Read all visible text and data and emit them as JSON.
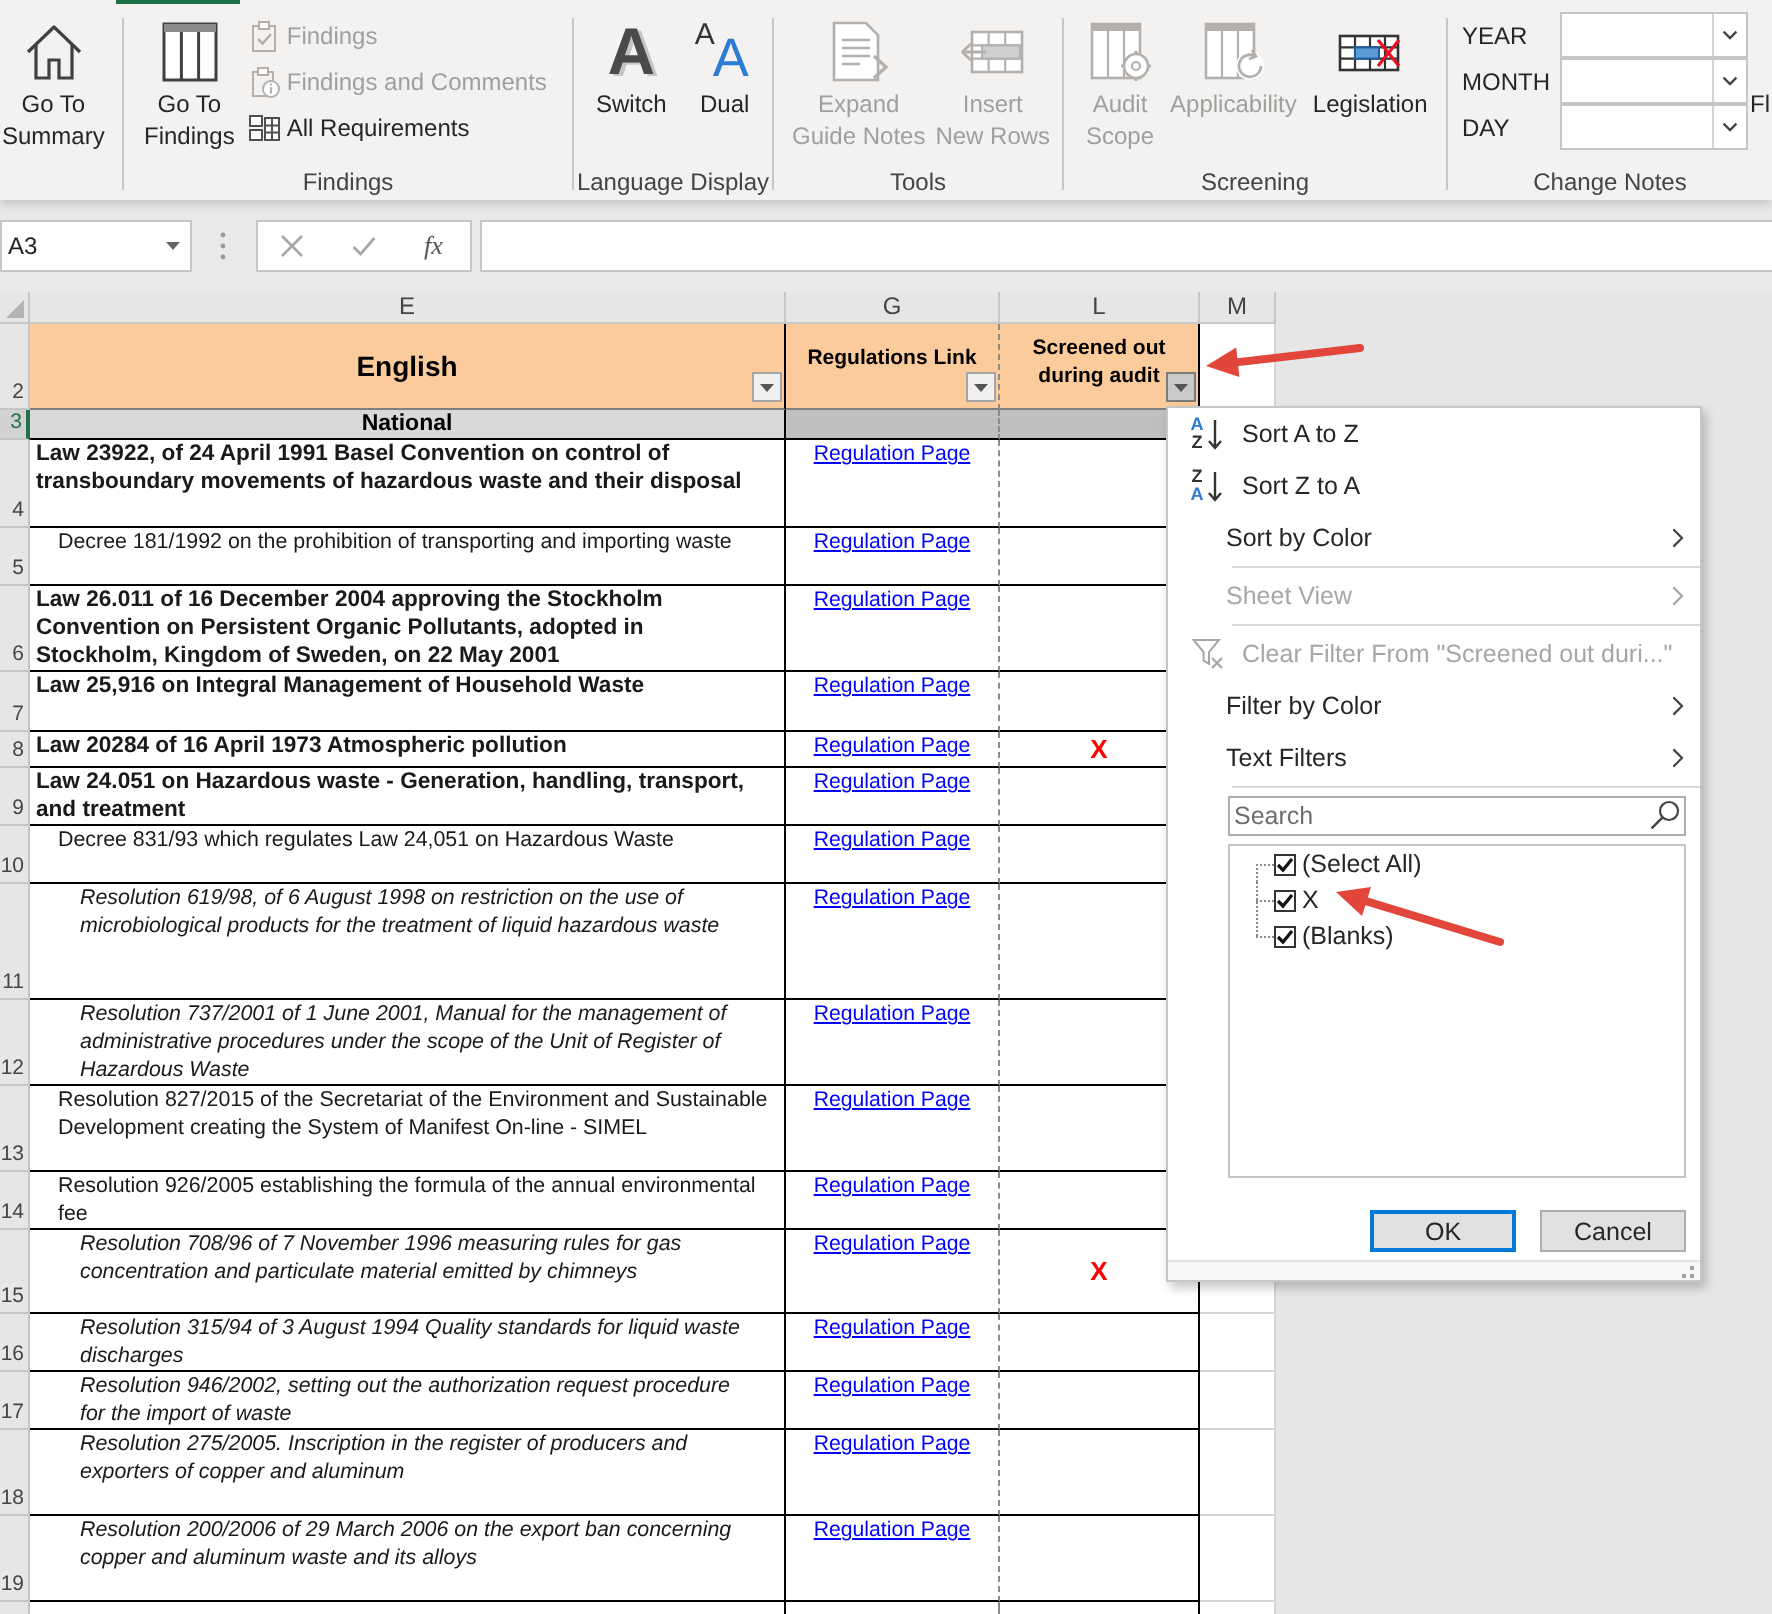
{
  "ribbon": {
    "groups": [
      {
        "buttons": [
          {
            "label": "Go To\nSummary",
            "disabled": false
          }
        ]
      },
      {
        "label": "Findings",
        "buttons": [
          {
            "label": "Go To\nFindings",
            "disabled": false
          }
        ],
        "small_buttons": [
          {
            "label": "Findings",
            "disabled": true
          },
          {
            "label": "Findings and Comments",
            "disabled": true
          },
          {
            "label": "All Requirements",
            "disabled": false
          }
        ]
      },
      {
        "label": "Language Display",
        "buttons": [
          {
            "label": "Switch",
            "disabled": false,
            "glyphs": [
              "A"
            ]
          },
          {
            "label": "Dual",
            "disabled": false,
            "glyphs": [
              "A",
              "A"
            ]
          }
        ]
      },
      {
        "label": "Tools",
        "buttons": [
          {
            "label": "Expand\nGuide Notes",
            "disabled": true
          },
          {
            "label": "Insert\nNew Rows",
            "disabled": true
          }
        ]
      },
      {
        "label": "Screening",
        "buttons": [
          {
            "label": "Audit\nScope",
            "disabled": true
          },
          {
            "label": "Applicability",
            "disabled": true
          },
          {
            "label": "Legislation",
            "disabled": false
          }
        ]
      },
      {
        "label": "Change Notes",
        "fields": [
          {
            "label": "YEAR"
          },
          {
            "label": "MONTH"
          },
          {
            "label": "DAY"
          }
        ],
        "cut_off_label": "Fl"
      }
    ]
  },
  "formula_bar": {
    "name_box": "A3",
    "function_glyph": "fx"
  },
  "sheet": {
    "column_letters": [
      "E",
      "G",
      "L",
      "M"
    ],
    "header_row": {
      "row_number": "2",
      "selected": false,
      "cells": [
        {
          "text": "English",
          "filter_open": false
        },
        {
          "text": "Regulations Link",
          "filter_open": false
        },
        {
          "text": "Screened out\nduring audit",
          "filter_open": true
        }
      ]
    },
    "section_row": {
      "row_number": "3",
      "selected": true,
      "label": "National"
    },
    "rows": [
      {
        "row_number": "4",
        "selected": false,
        "english": "Law 23922, of 24 April 1991 Basel Convention on control of\ntransboundary movements of hazardous waste and their disposal",
        "link": "Regulation Page",
        "children": [
          {
            "row_number": "5",
            "selected": false,
            "english": "Decree 181/1992 on the prohibition of transporting and importing waste",
            "link": "Regulation Page"
          }
        ]
      },
      {
        "row_number": "6",
        "selected": false,
        "english": "Law 26.011 of 16 December 2004 approving the Stockholm\nConvention on Persistent Organic Pollutants, adopted in\nStockholm, Kingdom of Sweden, on 22 May 2001",
        "link": "Regulation Page"
      },
      {
        "row_number": "7",
        "selected": false,
        "english": "Law 25,916 on Integral Management of Household Waste",
        "link": "Regulation Page"
      },
      {
        "row_number": "8",
        "selected": false,
        "english": "Law 20284 of 16 April 1973 Atmospheric pollution",
        "link": "Regulation Page",
        "screened_out": "X"
      },
      {
        "row_number": "9",
        "selected": false,
        "english": "Law 24.051 on Hazardous waste - Generation, handling, transport,\nand treatment",
        "link": "Regulation Page",
        "children": [
          {
            "row_number": "10",
            "selected": false,
            "english": "Decree 831/93 which regulates Law 24,051 on Hazardous Waste",
            "link": "Regulation Page",
            "children": [
              {
                "row_number": "11",
                "selected": false,
                "english": "Resolution 619/98, of 6 August 1998 on restriction on the use of\nmicrobiological products for the treatment of liquid hazardous waste",
                "link": "Regulation Page"
              },
              {
                "row_number": "12",
                "selected": false,
                "english": "Resolution 737/2001 of 1 June 2001, Manual for the management of\nadministrative procedures under the scope of the Unit of Register of\nHazardous Waste",
                "link": "Regulation Page"
              }
            ]
          },
          {
            "row_number": "13",
            "selected": false,
            "english": "Resolution 827/2015 of the Secretariat of the Environment and Sustainable\nDevelopment creating the System of Manifest On-line - SIMEL",
            "link": "Regulation Page"
          },
          {
            "row_number": "14",
            "selected": false,
            "english": "Resolution 926/2005 establishing the formula of the annual environmental\nfee",
            "link": "Regulation Page",
            "children": [
              {
                "row_number": "15",
                "selected": false,
                "english": "Resolution 708/96 of 7 November 1996 measuring rules for gas\nconcentration and particulate material emitted by chimneys",
                "link": "Regulation Page",
                "screened_out": "X"
              },
              {
                "row_number": "16",
                "selected": false,
                "english": "Resolution 315/94 of 3 August 1994 Quality standards for liquid waste\ndischarges",
                "link": "Regulation Page"
              },
              {
                "row_number": "17",
                "selected": false,
                "english": "Resolution 946/2002, setting out the authorization request procedure\nfor the import of waste",
                "link": "Regulation Page"
              },
              {
                "row_number": "18",
                "selected": false,
                "english": "Resolution 275/2005. Inscription in the register of producers and\nexporters of copper and aluminum",
                "link": "Regulation Page"
              },
              {
                "row_number": "19",
                "selected": false,
                "english": "Resolution 200/2006 of 29 March 2006 on the export ban concerning\ncopper and aluminum waste and its alloys",
                "link": "Regulation Page"
              }
            ]
          }
        ]
      }
    ]
  },
  "filter_menu": {
    "items": [
      {
        "kind": "sort_ascending",
        "icon_letters": [
          "A",
          "Z"
        ],
        "label": "Sort A to Z",
        "disabled": false
      },
      {
        "kind": "sort_descending",
        "icon_letters": [
          "Z",
          "A"
        ],
        "label": "Sort Z to A",
        "disabled": false
      },
      {
        "kind": "submenu",
        "label": "Sort by Color",
        "disabled": false
      },
      {
        "kind": "separator"
      },
      {
        "kind": "submenu",
        "label": "Sheet View",
        "disabled": true
      },
      {
        "kind": "separator"
      },
      {
        "kind": "clear",
        "label": "Clear Filter From \"Screened out duri...\"",
        "disabled": true
      },
      {
        "kind": "submenu",
        "label": "Filter by Color",
        "disabled": false
      },
      {
        "kind": "submenu",
        "label": "Text Filters",
        "disabled": false
      },
      {
        "kind": "separator"
      }
    ],
    "search": {
      "placeholder": "Search"
    },
    "values": [
      {
        "label": "(Select All)",
        "checked": true
      },
      {
        "label": "X",
        "checked": true
      },
      {
        "label": "(Blanks)",
        "checked": true
      }
    ],
    "buttons": [
      {
        "label": "OK",
        "focused": true
      },
      {
        "label": "Cancel",
        "focused": false
      }
    ]
  }
}
